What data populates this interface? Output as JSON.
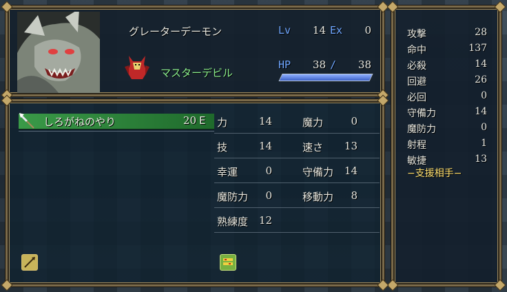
{
  "unit": {
    "name": "グレーターデーモン",
    "class": "マスターデビル",
    "level_label": "Lv",
    "level": "14",
    "exp_label": "Ex",
    "exp": "0",
    "hp_label": "HP",
    "hp_current": "38",
    "hp_separator": "/",
    "hp_max": "38",
    "hp_fraction": 1.0
  },
  "weapon": {
    "name": "しろがねのやり",
    "uses": "20",
    "rank": "E"
  },
  "stats": [
    {
      "label": "力",
      "value": "14"
    },
    {
      "label": "魔力",
      "value": "0"
    },
    {
      "label": "技",
      "value": "14"
    },
    {
      "label": "速さ",
      "value": "13"
    },
    {
      "label": "幸運",
      "value": "0"
    },
    {
      "label": "守備力",
      "value": "14"
    },
    {
      "label": "魔防力",
      "value": "0"
    },
    {
      "label": "移動力",
      "value": "8"
    },
    {
      "label": "熟練度",
      "value": "12"
    }
  ],
  "combat": [
    {
      "label": "攻撃",
      "value": "28"
    },
    {
      "label": "命中",
      "value": "137"
    },
    {
      "label": "必殺",
      "value": "14"
    },
    {
      "label": "回避",
      "value": "26"
    },
    {
      "label": "必回",
      "value": "0"
    },
    {
      "label": "守備力",
      "value": "14"
    },
    {
      "label": "魔防力",
      "value": "0"
    },
    {
      "label": "射程",
      "value": "1"
    },
    {
      "label": "敏捷",
      "value": "13"
    }
  ],
  "support_label": "−支援相手−",
  "icons": {
    "weapon": "lance-icon",
    "weapon_rank": "lance-rank-icon",
    "item": "item-bag-icon"
  },
  "colors": {
    "label_blue": "#6ea6ff",
    "class_green": "#8cf08c",
    "weapon_highlight": "#2f8a3c"
  }
}
